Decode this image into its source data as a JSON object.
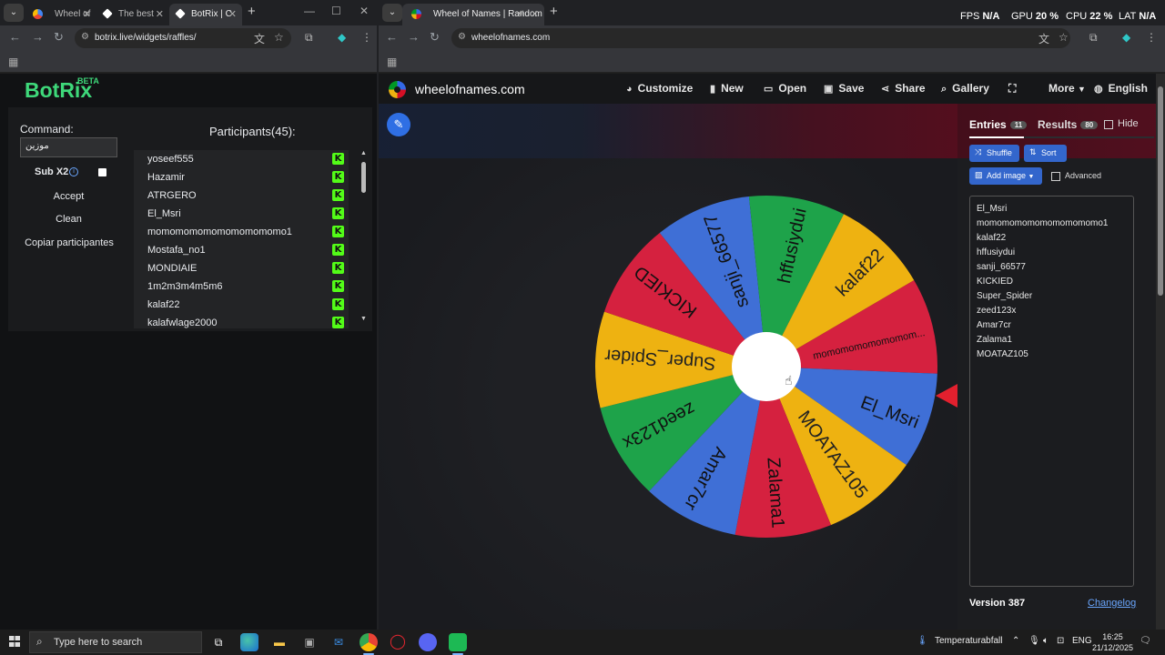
{
  "left_browser": {
    "tabs": [
      {
        "label": "Wheel of",
        "fav": "#4285f4"
      },
      {
        "label": "The best",
        "fav": "#ffffff"
      },
      {
        "label": "BotRix | C",
        "fav": "#ffffff"
      }
    ],
    "url": "botrix.live/widgets/raffles/"
  },
  "botrix": {
    "logo": "BotRix",
    "beta": "BETA",
    "command_label": "Command:",
    "command_value": "موزين",
    "sub_label": "Sub X2",
    "accept": "Accept",
    "clean": "Clean",
    "copy": "Copiar participantes",
    "participants_title": "Participants(45):",
    "participants": [
      "yoseef555",
      "Hazamir",
      "ATRGERO",
      "El_Msri",
      "momomomomomomomomomo1",
      "Mostafa_no1",
      "MONDIAIE",
      "1m2m3m4m5m6",
      "kalaf22",
      "kalafwlage2000"
    ],
    "k_badge": "K"
  },
  "right_browser": {
    "tab_label": "Wheel of Names | Random",
    "url": "wheelofnames.com"
  },
  "hud": {
    "fps_label": "FPS",
    "fps_value": "N/A",
    "gpu_label": "GPU",
    "gpu_value": "20 %",
    "cpu_label": "CPU",
    "cpu_value": "22 %",
    "lat_label": "LAT",
    "lat_value": "N/A"
  },
  "won": {
    "site": "wheelofnames.com",
    "menu": [
      "Customize",
      "New",
      "Open",
      "Save",
      "Share",
      "Gallery",
      "",
      "More",
      "English"
    ],
    "tab_entries": "Entries",
    "entries_count": "11",
    "tab_results": "Results",
    "results_count": "80",
    "hide": "Hide",
    "shuffle": "Shuffle",
    "sort": "Sort",
    "add_image": "Add image",
    "advanced": "Advanced",
    "entries": [
      "El_Msri",
      "momomomomomomomomomo1",
      "kalaf22",
      "hffusiydui",
      "sanji_66577",
      "KICKIED",
      "Super_Spider",
      "zeed123x",
      "Amar7cr",
      "Zalama1",
      "MOATAZ105"
    ],
    "version": "Version 387",
    "changelog": "Changelog",
    "wheel_slices": [
      {
        "label": "momomomomomomom...",
        "color": "#d5213f"
      },
      {
        "label": "El_Msri",
        "color": "#3f6fd6"
      },
      {
        "label": "MOATAZ105",
        "color": "#eeb211"
      },
      {
        "label": "Zalama1",
        "color": "#d5213f"
      },
      {
        "label": "Amar7cr",
        "color": "#3f6fd6"
      },
      {
        "label": "zeed123x",
        "color": "#1ea34a"
      },
      {
        "label": "Super_Spider",
        "color": "#eeb211"
      },
      {
        "label": "KICKIED",
        "color": "#d5213f"
      },
      {
        "label": "sanji_66577",
        "color": "#3f6fd6"
      },
      {
        "label": "hffusiydui",
        "color": "#1ea34a"
      },
      {
        "label": "kalaf22",
        "color": "#eeb211"
      }
    ]
  },
  "taskbar": {
    "search_placeholder": "Type here to search",
    "weather": "Temperaturabfall",
    "lang": "ENG",
    "time": "16:25",
    "date": "21/12/2025"
  }
}
